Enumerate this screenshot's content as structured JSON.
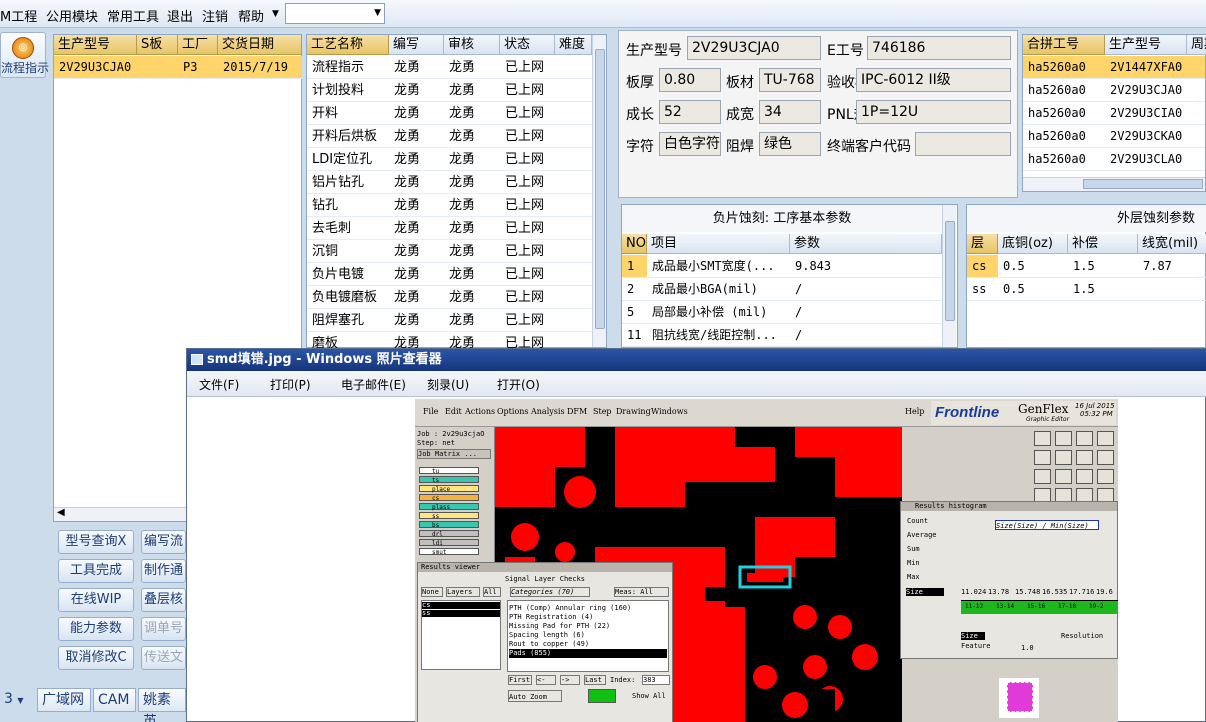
{
  "menu": {
    "items": [
      "M工程",
      "公用模块",
      "常用工具",
      "退出",
      "注销",
      "帮助"
    ],
    "combo": ""
  },
  "leftbtn": {
    "label": "流程指示"
  },
  "orders": {
    "headers": [
      "生产型号",
      "S板",
      "工厂",
      "交货日期"
    ],
    "rows": [
      [
        "2V29U3CJA0",
        "",
        "P3",
        "2015/7/19"
      ]
    ]
  },
  "process": {
    "headers": [
      "工艺名称",
      "编写",
      "审核",
      "状态",
      "难度"
    ],
    "rows": [
      [
        "流程指示",
        "龙勇",
        "龙勇",
        "已上网",
        ""
      ],
      [
        "计划投料",
        "龙勇",
        "龙勇",
        "已上网",
        ""
      ],
      [
        "开料",
        "龙勇",
        "龙勇",
        "已上网",
        ""
      ],
      [
        "开料后烘板",
        "龙勇",
        "龙勇",
        "已上网",
        ""
      ],
      [
        "LDI定位孔",
        "龙勇",
        "龙勇",
        "已上网",
        ""
      ],
      [
        "铝片钻孔",
        "龙勇",
        "龙勇",
        "已上网",
        ""
      ],
      [
        "钻孔",
        "龙勇",
        "龙勇",
        "已上网",
        ""
      ],
      [
        "去毛刺",
        "龙勇",
        "龙勇",
        "已上网",
        ""
      ],
      [
        "沉铜",
        "龙勇",
        "龙勇",
        "已上网",
        ""
      ],
      [
        "负片电镀",
        "龙勇",
        "龙勇",
        "已上网",
        ""
      ],
      [
        "负电镀磨板",
        "龙勇",
        "龙勇",
        "已上网",
        ""
      ],
      [
        "阻焊塞孔",
        "龙勇",
        "龙勇",
        "已上网",
        ""
      ],
      [
        "磨板",
        "龙勇",
        "龙勇",
        "已上网",
        ""
      ]
    ]
  },
  "info": {
    "model_label": "生产型号",
    "model": "2V29U3CJA0",
    "e_label": "E工号",
    "e": "746186",
    "thick_label": "板厚",
    "thick": "0.80",
    "mat_label": "板材",
    "mat": "TU-768",
    "std_label": "验收标准",
    "std": "IPC-6012 II级",
    "long_label": "成长",
    "long": "52",
    "wide_label": "成宽",
    "wide": "34",
    "pnl_label": "PNL规格",
    "pnl": "1P=12U",
    "char_label": "字符",
    "char": "白色字符",
    "mask_label": "阻焊",
    "mask": "绿色",
    "cust_label": "终端客户代码",
    "cust": ""
  },
  "merge": {
    "headers": [
      "合拼工号",
      "生产型号",
      "周期"
    ],
    "rows": [
      [
        "ha5260a0",
        "2V1447XFA0"
      ],
      [
        "ha5260a0",
        "2V29U3CJA0"
      ],
      [
        "ha5260a0",
        "2V29U3CIA0"
      ],
      [
        "ha5260a0",
        "2V29U3CKA0"
      ],
      [
        "ha5260a0",
        "2V29U3CLA0"
      ]
    ]
  },
  "etch": {
    "title": "负片蚀刻: 工序基本参数",
    "headers": [
      "NO",
      "项目",
      "参数"
    ],
    "rows": [
      [
        "1",
        "成品最小SMT宽度(...",
        "9.843"
      ],
      [
        "2",
        "成品最小BGA(mil)",
        "/"
      ],
      [
        "5",
        "局部最小补偿 (mil)",
        "/"
      ],
      [
        "11",
        "阻抗线宽/线距控制...",
        "/"
      ]
    ]
  },
  "outer": {
    "title": "外层蚀刻参数",
    "headers": [
      "层",
      "底铜(oz)",
      "补偿",
      "线宽(mil)"
    ],
    "rows": [
      [
        "cs",
        "0.5",
        "1.5",
        "7.87"
      ],
      [
        "ss",
        "0.5",
        "1.5",
        ""
      ]
    ]
  },
  "buttons": [
    "型号查询X",
    "编写流",
    "工具完成",
    "制作通",
    "在线WIP",
    "叠层核",
    "能力参数",
    "调单号",
    "取消修改C",
    "传送文"
  ],
  "tabs": {
    "num": "3",
    "items": [
      "广域网",
      "CAM",
      "姚素英"
    ]
  },
  "viewer": {
    "title": "smd填错.jpg - Windows 照片查看器",
    "menu": [
      "文件(F)",
      "打印(P)",
      "电子邮件(E)",
      "刻录(U)",
      "打开(O)"
    ]
  },
  "genflex": {
    "menu": [
      "File",
      "Edit",
      "Actions",
      "Options",
      "Analysis",
      "DFM",
      "Step",
      "Drawing",
      "Windows",
      "Help"
    ],
    "brand": "Frontline",
    "product": "GenFlex",
    "product_sub": "Graphic Editor",
    "date": "16 Jul 2015",
    "time": "05:32 PM",
    "job": "Job : 2v29u3cjaO",
    "step": "Step: net",
    "matrix": "Job Matrix ...",
    "layers": [
      "tu",
      "ts",
      "place",
      "cs",
      "plass",
      "ss",
      "bs",
      "drl",
      "ldi",
      "smut"
    ],
    "rv_title": "Results viewer",
    "rv_head": "Signal Layer Checks",
    "rv_none": "None",
    "rv_layers": "Layers",
    "rv_all": "All",
    "rv_cat": "Categories (70)",
    "rv_meas": "Meas: All",
    "rv_layerlist": [
      "cs",
      "ss"
    ],
    "rv_items": [
      "PTH (Comp) Annular ring (160)",
      "PTH Registration (4)",
      "Missing Pad for PTH (22)",
      "Spacing length (6)",
      "Rout to copper (49)",
      "Pads (855)"
    ],
    "rv_first": "First",
    "rv_last": "Last",
    "rv_index": "Index:",
    "rv_index_val": "383",
    "rv_zoom": "Auto Zoom",
    "rv_show": "Show All",
    "hist_title": "Results histogram",
    "hist_opts": [
      "Count",
      "Average",
      "Sum",
      "Min",
      "Max"
    ],
    "hist_size": "Size",
    "hist_label": "Size(Size) / Min(Size)",
    "hist_vals": [
      "11.024",
      "13.78",
      "15.748",
      "16.535",
      "17.716",
      "19.6"
    ],
    "hist_bins": [
      "11-12",
      "13-14",
      "15-16",
      "17-18",
      "19-2"
    ],
    "hist_res": "Resolution",
    "hist_res_val": "1.0",
    "hist_feat": "Feature"
  }
}
